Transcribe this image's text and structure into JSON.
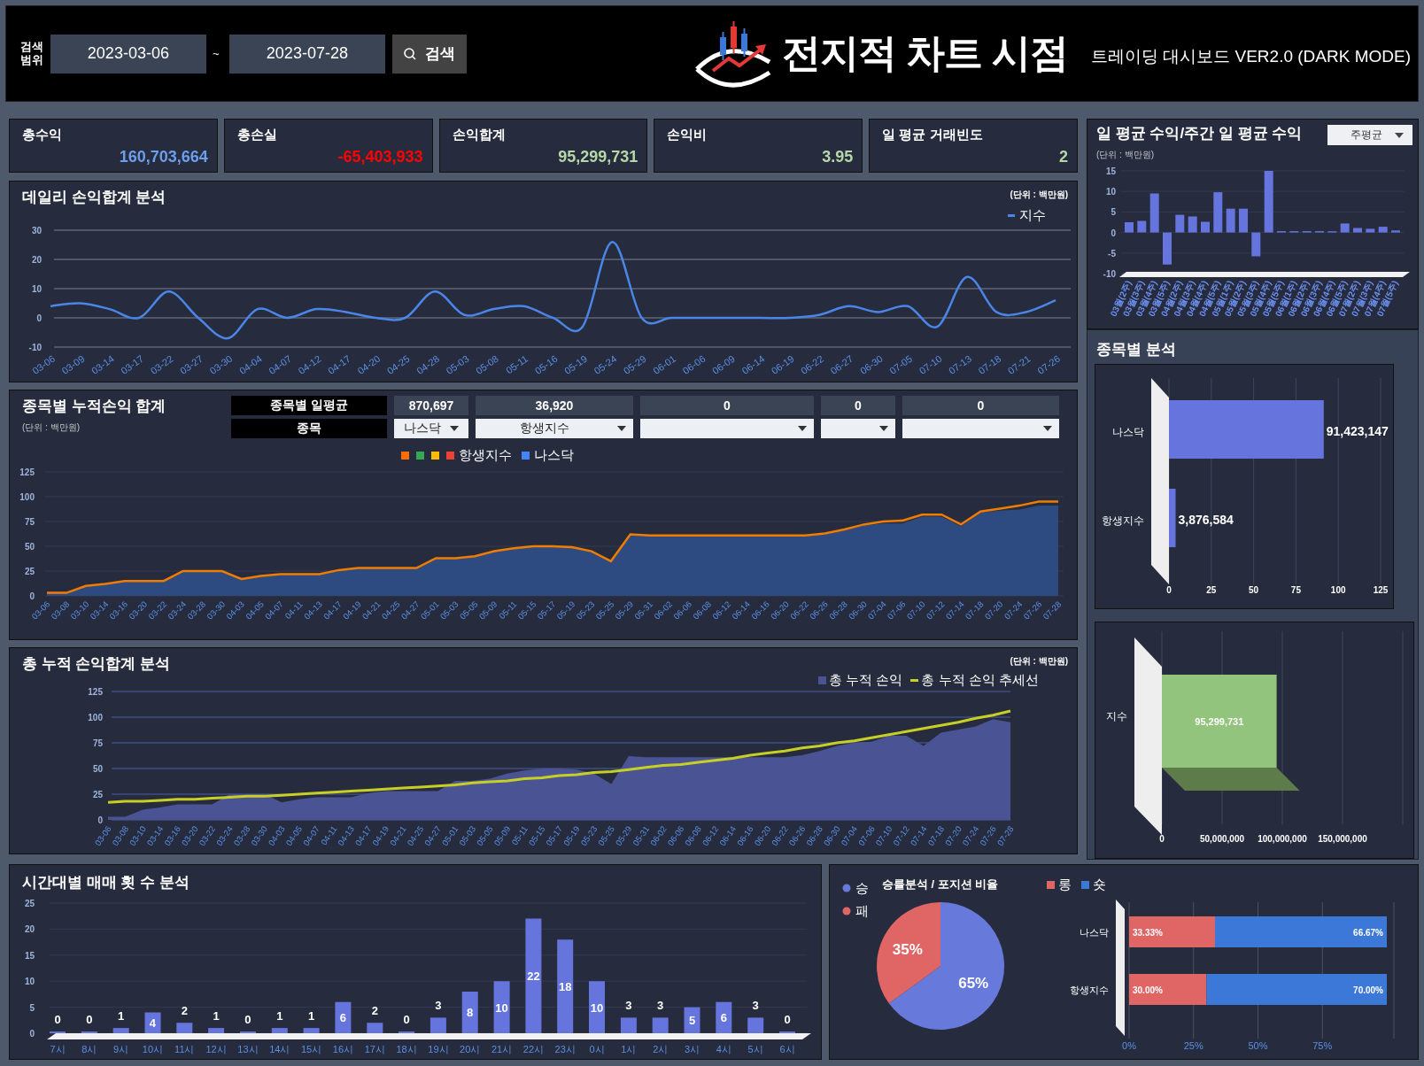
{
  "header": {
    "search_label": "검색 범위",
    "date_from": "2023-03-06",
    "separator": "~",
    "date_to": "2023-07-28",
    "search_button": "검색",
    "logo": "전지적 차트 시점",
    "subtitle": "트레이딩 대시보드 VER2.0 (DARK MODE)"
  },
  "kpis": [
    {
      "label": "총수익",
      "value": "160,703,664",
      "color": "#6d9eeb"
    },
    {
      "label": "총손실",
      "value": "-65,403,933",
      "color": "#ff0000"
    },
    {
      "label": "손익합계",
      "value": "95,299,731",
      "color": "#b6d7a8"
    },
    {
      "label": "손익비",
      "value": "3.95",
      "color": "#b6d7a8"
    },
    {
      "label": "일 평균 거래빈도",
      "value": "2",
      "color": "#b6d7a8"
    }
  ],
  "daily_panel": {
    "title": "데일리 손익합계 분석",
    "unit": "(단위 : 백만원)",
    "chart_data": {
      "type": "line",
      "grid": true,
      "categories": [
        "03-06",
        "03-09",
        "03-14",
        "03-17",
        "03-22",
        "03-27",
        "03-30",
        "04-04",
        "04-07",
        "04-12",
        "04-17",
        "04-20",
        "04-25",
        "04-28",
        "05-03",
        "05-08",
        "05-11",
        "05-16",
        "05-19",
        "05-24",
        "05-29",
        "06-01",
        "06-06",
        "06-09",
        "06-14",
        "06-19",
        "06-22",
        "06-27",
        "06-30",
        "07-05",
        "07-10",
        "07-13",
        "07-18",
        "07-21",
        "07-26"
      ],
      "series": [
        {
          "name": "지수",
          "color": "#4a86e8",
          "values": [
            4,
            5,
            3,
            0,
            9,
            0,
            -7,
            3,
            0,
            3,
            2,
            0,
            0,
            9,
            1,
            3,
            4,
            0,
            -3,
            26,
            0,
            0,
            0,
            0,
            0,
            0,
            1,
            4,
            2,
            4,
            -3,
            14,
            2,
            2,
            6
          ]
        }
      ],
      "ylim": [
        -10,
        30
      ],
      "yticks": [
        -10,
        0,
        10,
        20,
        30
      ]
    }
  },
  "weekly_panel": {
    "title": "일 평균 수익/주간 일 평균 수익",
    "unit": "(단위 : 백만원)",
    "dropdown": "주평균",
    "chart_data": {
      "type": "bar",
      "grid": true,
      "categories": [
        "03월(2주)",
        "03월(3주)",
        "03월(4주)",
        "03월(5주)",
        "04월(2주)",
        "04월(3주)",
        "04월(4주)",
        "04월(5주)",
        "05월(1주)",
        "05월(2주)",
        "05월(3주)",
        "05월(4주)",
        "05월(5주)",
        "06월(1주)",
        "06월(2주)",
        "06월(3주)",
        "06월(4주)",
        "06월(5주)",
        "07월(2주)",
        "07월(3주)",
        "07월(4주)",
        "07월(5주)"
      ],
      "values": [
        2.5,
        2.8,
        9.5,
        -7.8,
        4.3,
        3.9,
        2.6,
        9.8,
        5.8,
        5.8,
        -5.8,
        15,
        0,
        0,
        0,
        0,
        0.3,
        2.2,
        1.1,
        0.9,
        1.4,
        0.5
      ],
      "ylim": [
        -10,
        15
      ],
      "yticks": [
        -10,
        -5,
        0,
        5,
        10,
        15
      ]
    }
  },
  "cumulative_panel": {
    "title": "종목별 누적손익 합계",
    "unit": "(단위 : 백만원)",
    "avg_label": "종목별 일평균",
    "avg_values": [
      "870,697",
      "36,920",
      "0",
      "0",
      "0"
    ],
    "symbol_label": "종목",
    "symbol_selects": [
      {
        "kind": "filled",
        "value": "나스닥"
      },
      {
        "kind": "filled",
        "value": "항생지수"
      },
      {
        "kind": "empty"
      },
      {
        "kind": "empty"
      },
      {
        "kind": "empty"
      }
    ],
    "legend": [
      {
        "color": "#ff6d01"
      },
      {
        "color": "#34a853"
      },
      {
        "color": "#fbbc04"
      },
      {
        "color": "#ea4335"
      },
      {
        "color": "#4285f4"
      }
    ],
    "chart_data": {
      "type": "area",
      "grid": true,
      "categories": [
        "03-06",
        "03-08",
        "03-10",
        "03-14",
        "03-16",
        "03-20",
        "03-22",
        "03-24",
        "03-28",
        "03-30",
        "04-03",
        "04-05",
        "04-07",
        "04-11",
        "04-13",
        "04-17",
        "04-19",
        "04-21",
        "04-25",
        "04-27",
        "05-01",
        "05-03",
        "05-05",
        "05-09",
        "05-11",
        "05-15",
        "05-17",
        "05-19",
        "05-23",
        "05-25",
        "05-29",
        "05-31",
        "06-02",
        "06-06",
        "06-08",
        "06-12",
        "06-14",
        "06-16",
        "06-20",
        "06-22",
        "06-26",
        "06-28",
        "06-30",
        "07-04",
        "07-06",
        "07-10",
        "07-12",
        "07-14",
        "07-18",
        "07-20",
        "07-24",
        "07-26",
        "07-28"
      ],
      "series": [
        {
          "name": "나스닥",
          "type": "area",
          "color": "#2d4b80",
          "values": [
            3,
            3,
            10,
            12,
            15,
            15,
            15,
            25,
            25,
            25,
            17,
            20,
            22,
            22,
            22,
            26,
            28,
            28,
            28,
            28,
            38,
            38,
            40,
            45,
            48,
            50,
            50,
            49,
            45,
            35,
            62,
            61,
            61,
            61,
            61,
            61,
            61,
            61,
            61,
            61,
            62,
            66,
            71,
            73,
            73,
            80,
            80,
            70,
            84,
            86,
            87,
            91,
            91
          ]
        },
        {
          "name": "항생지수",
          "type": "line",
          "color": "#f07c00",
          "values": [
            3,
            3,
            10,
            12,
            15,
            15,
            15,
            25,
            25,
            25,
            17,
            20,
            22,
            22,
            22,
            26,
            28,
            28,
            28,
            28,
            38,
            38,
            40,
            45,
            48,
            50,
            50,
            49,
            45,
            35,
            62,
            61,
            61,
            61,
            61,
            61,
            61,
            61,
            61,
            61,
            63,
            67,
            72,
            75,
            76,
            82,
            82,
            72,
            85,
            88,
            91,
            95,
            95
          ]
        }
      ],
      "ylim": [
        0,
        125
      ],
      "yticks": [
        0,
        25,
        50,
        75,
        100,
        125
      ]
    }
  },
  "total_panel": {
    "title": "총 누적 손익합계 분석",
    "unit": "(단위 : 백만원)",
    "chart_data": {
      "type": "area",
      "grid": true,
      "categories": [
        "03-06",
        "03-08",
        "03-10",
        "03-14",
        "03-16",
        "03-20",
        "03-22",
        "03-24",
        "03-28",
        "03-30",
        "04-03",
        "04-05",
        "04-07",
        "04-11",
        "04-13",
        "04-17",
        "04-19",
        "04-21",
        "04-25",
        "04-27",
        "05-01",
        "05-03",
        "05-05",
        "05-09",
        "05-11",
        "05-15",
        "05-17",
        "05-19",
        "05-23",
        "05-25",
        "05-29",
        "05-31",
        "06-02",
        "06-06",
        "06-08",
        "06-12",
        "06-14",
        "06-16",
        "06-20",
        "06-22",
        "06-26",
        "06-28",
        "06-30",
        "07-04",
        "07-06",
        "07-10",
        "07-12",
        "07-14",
        "07-18",
        "07-20",
        "07-24",
        "07-26",
        "07-28"
      ],
      "series": [
        {
          "name": "총 누적 손익",
          "type": "area",
          "color": "#4a5494",
          "values": [
            3,
            3,
            10,
            12,
            15,
            15,
            15,
            25,
            25,
            25,
            17,
            20,
            22,
            22,
            22,
            26,
            28,
            28,
            28,
            28,
            38,
            38,
            40,
            45,
            48,
            50,
            50,
            49,
            45,
            35,
            62,
            61,
            61,
            61,
            61,
            61,
            61,
            61,
            61,
            61,
            63,
            67,
            72,
            75,
            76,
            82,
            82,
            72,
            85,
            88,
            91,
            98,
            95
          ]
        },
        {
          "name": "총 누적 손익 추세선",
          "type": "line",
          "color": "#c8cf24",
          "values": [
            17,
            18,
            18,
            19,
            20,
            20,
            21,
            22,
            23,
            23,
            24,
            25,
            26,
            27,
            28,
            29,
            30,
            31,
            32,
            33,
            34,
            36,
            37,
            38,
            40,
            41,
            43,
            44,
            46,
            47,
            49,
            51,
            53,
            54,
            56,
            58,
            60,
            63,
            65,
            67,
            70,
            72,
            75,
            77,
            80,
            83,
            86,
            89,
            92,
            95,
            99,
            102,
            106
          ]
        }
      ],
      "ylim": [
        0,
        125
      ],
      "yticks": [
        0,
        25,
        50,
        75,
        100,
        125
      ]
    }
  },
  "symbol_section": {
    "title": "종목별 분석",
    "profit_chart": {
      "chart_data": {
        "type": "bar",
        "orientation": "horizontal",
        "grid": true,
        "categories": [
          "나스닥",
          "항생지수"
        ],
        "values": [
          91.4,
          3.9
        ],
        "annotations": [
          {
            "text": "91,423,147"
          },
          {
            "text": "3,876,584"
          }
        ],
        "xlim": [
          0,
          125
        ],
        "xticks": [
          0,
          25,
          50,
          75,
          100,
          125
        ]
      }
    },
    "total_chart": {
      "chart_data": {
        "type": "bar",
        "orientation": "horizontal",
        "grid": true,
        "categories": [
          "지수"
        ],
        "values": [
          95299731
        ],
        "value_labels": [
          "95,299,731"
        ],
        "xlim": [
          0,
          200000000
        ],
        "xticks": [
          0,
          {
            "value": 50000000,
            "label": "50,000,000"
          },
          {
            "value": 100000000,
            "label": "100,000,000"
          },
          {
            "value": 150000000,
            "label": "150,000,000"
          }
        ]
      }
    }
  },
  "hour_panel": {
    "title": "시간대별 매매 횟 수 분석",
    "chart_data": {
      "type": "bar",
      "grid": true,
      "categories": [
        "7시",
        "8시",
        "9시",
        "10시",
        "11시",
        "12시",
        "13시",
        "14시",
        "15시",
        "16시",
        "17시",
        "18시",
        "19시",
        "20시",
        "21시",
        "22시",
        "23시",
        "0시",
        "1시",
        "2시",
        "3시",
        "4시",
        "5시",
        "6시"
      ],
      "values": [
        0,
        0,
        1,
        4,
        2,
        1,
        0,
        1,
        1,
        6,
        2,
        0,
        3,
        8,
        10,
        22,
        18,
        10,
        3,
        3,
        5,
        6,
        3,
        0
      ],
      "ylim": [
        0,
        25
      ],
      "yticks": [
        0,
        5,
        10,
        15,
        20,
        25
      ],
      "data_labels": true
    }
  },
  "win_panel": {
    "title": "승률분석 / 포지션 비율",
    "pie_chart": {
      "chart_data": {
        "type": "pie",
        "legend": "left",
        "categories": [
          "승",
          "패"
        ],
        "values": [
          65,
          35
        ],
        "value_labels": [
          "65%",
          "35%"
        ]
      }
    },
    "position_chart": {
      "chart_data": {
        "type": "bar",
        "orientation": "horizontal",
        "stacked": true,
        "grid": true,
        "legend": "top",
        "categories": [
          "나스닥",
          "항생지수"
        ],
        "series": [
          {
            "name": "롱",
            "color": "#e06666",
            "values": [
              33.33,
              30.0
            ],
            "value_labels": [
              "33.33%",
              "30.00%"
            ]
          },
          {
            "name": "숏",
            "color": "#3c78d8",
            "values": [
              66.67,
              70.0
            ],
            "value_labels": [
              "66.67%",
              "70.00%"
            ]
          }
        ],
        "xlim": [
          0,
          100
        ],
        "xticks": [
          {
            "value": 0,
            "label": "0%"
          },
          {
            "value": 25,
            "label": "25%"
          },
          {
            "value": 50,
            "label": "50%"
          },
          {
            "value": 75,
            "label": "75%"
          }
        ]
      }
    }
  }
}
